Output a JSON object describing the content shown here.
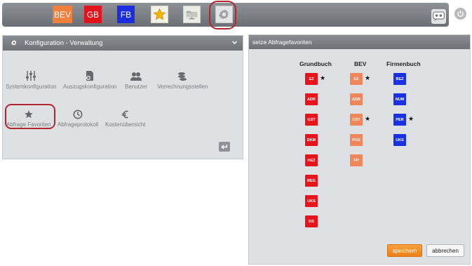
{
  "toolbar": {
    "bev_label": "BEV",
    "gb_label": "GB",
    "fb_label": "FB",
    "favorites_icon": "star-icon",
    "files_icon": "folder-network-icon",
    "config_icon": "gear-icon",
    "chat_icon": "chat-icon",
    "logout_icon": "power-icon",
    "colors": {
      "bev": "#f0803c",
      "gb": "#e0141a",
      "fb": "#1a2ee0"
    }
  },
  "config_panel": {
    "title": "Konfiguration - Verwaltung",
    "items": [
      {
        "label": "Systemkonfiguration",
        "icon": "sliders-icon"
      },
      {
        "label": "Auszugskonfiguration",
        "icon": "document-gear-icon"
      },
      {
        "label": "Benutzer",
        "icon": "users-icon"
      },
      {
        "label": "Verrechnungsstellen",
        "icon": "coins-icon"
      },
      {
        "label": "Abfrage Favoriten",
        "icon": "star-icon"
      },
      {
        "label": "Abfrageprotokoll",
        "icon": "clock-icon"
      },
      {
        "label": "Kostenübersicht",
        "icon": "euro-icon"
      }
    ]
  },
  "favorites_panel": {
    "title": "setze Abfragefavoriten",
    "columns": [
      {
        "title": "Grundbuch",
        "color": "#e8141c",
        "items": [
          {
            "code": "EZ",
            "favorite": true
          },
          {
            "code": "ADR",
            "favorite": false
          },
          {
            "code": "GST",
            "favorite": false
          },
          {
            "code": "DKM",
            "favorite": false
          },
          {
            "code": "HEZ",
            "favorite": false
          },
          {
            "code": "REG",
            "favorite": false
          },
          {
            "code": "UKS",
            "favorite": false
          },
          {
            "code": "DS",
            "favorite": false
          }
        ]
      },
      {
        "title": "BEV",
        "color": "#f0875c",
        "items": [
          {
            "code": "EZ",
            "favorite": true
          },
          {
            "code": "ADR",
            "favorite": false
          },
          {
            "code": "GST",
            "favorite": true
          },
          {
            "code": "POS",
            "favorite": false
          },
          {
            "code": "FP",
            "favorite": false
          }
        ]
      },
      {
        "title": "Firmenbuch",
        "color": "#1a30e4",
        "items": [
          {
            "code": "BEZ",
            "favorite": false
          },
          {
            "code": "NUM",
            "favorite": false
          },
          {
            "code": "PER",
            "favorite": true
          },
          {
            "code": "UKS",
            "favorite": false
          }
        ]
      }
    ],
    "save_label": "speichern",
    "cancel_label": "abbrechen"
  }
}
